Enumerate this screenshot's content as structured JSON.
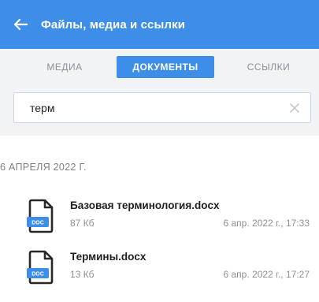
{
  "header": {
    "title": "Файлы, медиа и ссылки"
  },
  "tabs": [
    {
      "label": "МЕДИА",
      "active": false
    },
    {
      "label": "ДОКУМЕНТЫ",
      "active": true
    },
    {
      "label": "ССЫЛКИ",
      "active": false
    }
  ],
  "search": {
    "value": "терм"
  },
  "section": {
    "date": "6 АПРЕЛЯ 2022 Г."
  },
  "files": [
    {
      "name": "Базовая терминология.docx",
      "size": "87 Кб",
      "date": "6 апр. 2022 г., 17:33",
      "icon_label": "DOC"
    },
    {
      "name": "Термины.docx",
      "size": "13 Кб",
      "date": "6 апр. 2022 г., 17:27",
      "icon_label": "DOC"
    }
  ],
  "colors": {
    "accent": "#3d8ee9",
    "background_gray": "#f2f3f5"
  }
}
